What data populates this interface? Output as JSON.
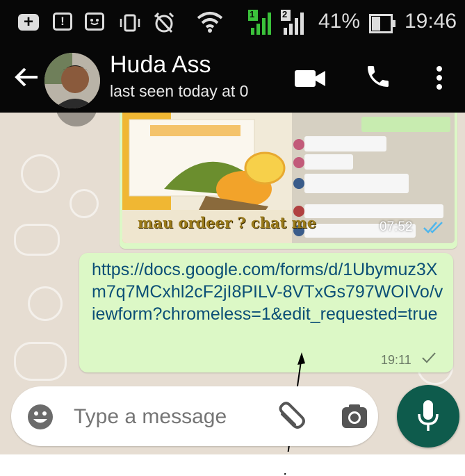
{
  "status_bar": {
    "sim1": "1",
    "sim2": "2",
    "battery_percent": "41%",
    "time": "19:46"
  },
  "header": {
    "contact_name": "Huda Ass",
    "last_seen": "last seen today at 0"
  },
  "messages": [
    {
      "type": "image",
      "caption_overlay": "mau ordeer ? chat me",
      "time": "07:52",
      "status": "read"
    },
    {
      "type": "text",
      "text": "https://docs.google.com/forms/d/1Ubymuz3Xm7q7MCxhl2cF2jI8PILV-8VTxGs797WOIVo/viewform?chromeless=1&edit_requested=true",
      "time": "19:11",
      "status": "sent"
    }
  ],
  "composer": {
    "placeholder": "Type a message"
  },
  "colors": {
    "outgoing_bubble": "#dcf8c6",
    "chat_background": "#e6ddd2",
    "mic_button": "#0e5b4c",
    "link": "#0b4f76",
    "read_ticks": "#4fb6ec"
  }
}
